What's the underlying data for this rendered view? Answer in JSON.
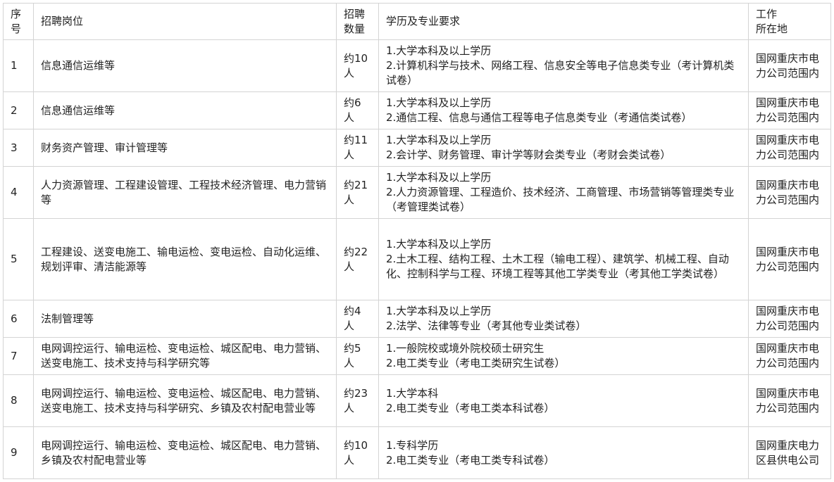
{
  "table": {
    "headers": {
      "index": [
        "序",
        "号"
      ],
      "position": "招聘岗位",
      "count": [
        "招聘",
        "数量"
      ],
      "requirement": "学历及专业要求",
      "location": [
        "工作",
        "所在地"
      ]
    },
    "rows": [
      {
        "index": "1",
        "position": "信息通信运维等",
        "count": "约10人",
        "req": [
          "1.大学本科及以上学历",
          "2.计算机科学与技术、网络工程、信息安全等电子信息类专业（考计算机类试卷）"
        ],
        "location": "国网重庆市电力公司范围内"
      },
      {
        "index": "2",
        "position": "信息通信运维等",
        "count": "约6人",
        "req": [
          "1.大学本科及以上学历",
          "2.通信工程、信息与通信工程等电子信息类专业（考通信类试卷）"
        ],
        "location": "国网重庆市电力公司范围内"
      },
      {
        "index": "3",
        "position": "财务资产管理、审计管理等",
        "count": "约11人",
        "req": [
          "1.大学本科及以上学历",
          "2.会计学、财务管理、审计学等财会类专业（考财会类试卷）"
        ],
        "location": "国网重庆市电力公司范围内"
      },
      {
        "index": "4",
        "position": "人力资源管理、工程建设管理、工程技术经济管理、电力营销等",
        "count": "约21人",
        "req": [
          "1.大学本科及以上学历",
          "2.人力资源管理、工程造价、技术经济、工商管理、市场营销等管理类专业（考管理类试卷）"
        ],
        "location": "国网重庆市电力公司范围内"
      },
      {
        "index": "5",
        "position": "工程建设、送变电施工、输电运检、变电运检、自动化运维、规划评审、清洁能源等",
        "count": "约22人",
        "req": [
          "1.大学本科及以上学历",
          "2.土木工程、结构工程、土木工程（输电工程）、建筑学、机械工程、自动化、控制科学与工程、环境工程等其他工学类专业（考其他工学类试卷）"
        ],
        "location": "国网重庆市电力公司范围内"
      },
      {
        "index": "6",
        "position": "法制管理等",
        "count": "约4人",
        "req": [
          "1.大学本科及以上学历",
          "2.法学、法律等专业（考其他专业类试卷）"
        ],
        "location": "国网重庆市电力公司范围内"
      },
      {
        "index": "7",
        "position": "电网调控运行、输电运检、变电运检、城区配电、电力营销、送变电施工、技术支持与科学研究等",
        "count": "约5人",
        "req": [
          "1.一般院校或境外院校硕士研究生",
          "2.电工类专业（考电工类研究生试卷）"
        ],
        "location": "国网重庆市电力公司范围内"
      },
      {
        "index": "8",
        "position": "电网调控运行、输电运检、变电运检、城区配电、电力营销、送变电施工、技术支持与科学研究、乡镇及农村配电营业等",
        "count": "约23人",
        "req": [
          "1.大学本科",
          "2.电工类专业（考电工类本科试卷）"
        ],
        "location": "国网重庆市电力公司范围内"
      },
      {
        "index": "9",
        "position": "电网调控运行、输电运检、变电运检、城区配电、电力营销、乡镇及农村配电营业等",
        "count": "约10人",
        "req": [
          "1.专科学历",
          "2.电工类专业（考电工类专科试卷）"
        ],
        "location": "国网重庆电力区县供电公司"
      }
    ]
  }
}
